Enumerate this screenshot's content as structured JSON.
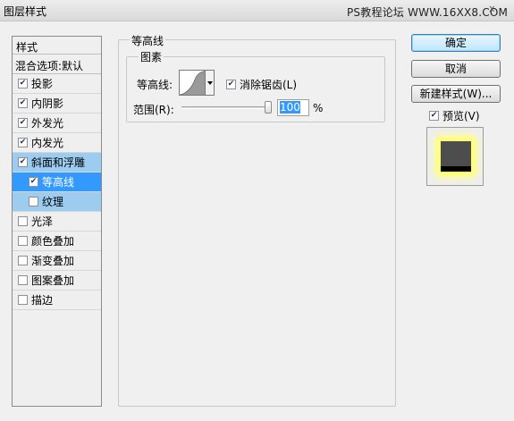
{
  "window": {
    "title": "图层样式",
    "watermark": "PS教程论坛 WWW.16XX8.COM",
    "close_glyph": "x"
  },
  "sidebar": {
    "header": "样式",
    "blend_options": "混合选项:默认",
    "items": [
      {
        "label": "投影",
        "checked": true
      },
      {
        "label": "内阴影",
        "checked": true
      },
      {
        "label": "外发光",
        "checked": true
      },
      {
        "label": "内发光",
        "checked": true
      },
      {
        "label": "斜面和浮雕",
        "checked": true
      },
      {
        "label": "等高线",
        "checked": true
      },
      {
        "label": "纹理",
        "checked": false
      },
      {
        "label": "光泽",
        "checked": false
      },
      {
        "label": "颜色叠加",
        "checked": false
      },
      {
        "label": "渐变叠加",
        "checked": false
      },
      {
        "label": "图案叠加",
        "checked": false
      },
      {
        "label": "描边",
        "checked": false
      }
    ]
  },
  "panel": {
    "group_title": "等高线",
    "subgroup_title": "图素",
    "contour_label": "等高线:",
    "anti_alias_label": "消除锯齿(L)",
    "anti_alias_checked": true,
    "range_label": "范围(R):",
    "range_value": "100",
    "range_unit": "%",
    "range_fraction": 1.0
  },
  "buttons": {
    "ok": "确定",
    "cancel": "取消",
    "new_style": "新建样式(W)...",
    "preview_label": "预览(V)",
    "preview_checked": true
  },
  "colors": {
    "selection_dark": "#3399ff",
    "selection_light": "#9ccdf1",
    "glow": "#ffff66"
  },
  "icons": {
    "check": "checkmark-icon",
    "dropdown": "chevron-down-icon"
  }
}
